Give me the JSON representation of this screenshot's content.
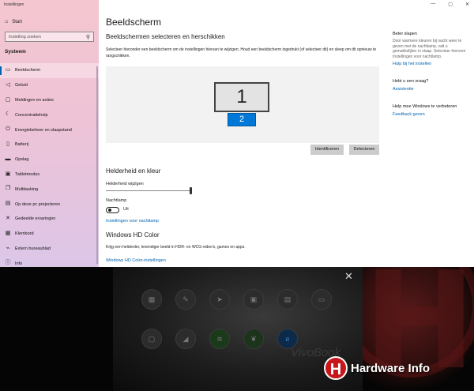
{
  "window": {
    "title": "Instellingen",
    "controls": [
      "—",
      "▢",
      "✕"
    ]
  },
  "sidebar": {
    "home_label": "Start",
    "search_placeholder": "Instelling zoeken",
    "section_title": "Systeem",
    "items": [
      {
        "label": "Beeldscherm",
        "icon": "monitor-icon",
        "glyph": "▭",
        "active": true
      },
      {
        "label": "Geluid",
        "icon": "speaker-icon",
        "glyph": "◁"
      },
      {
        "label": "Meldingen en acties",
        "icon": "notification-icon",
        "glyph": "▢"
      },
      {
        "label": "Concentratiehulp",
        "icon": "moon-icon",
        "glyph": "☾"
      },
      {
        "label": "Energiebeheer en slaapstand",
        "icon": "power-icon",
        "glyph": "⏻"
      },
      {
        "label": "Batterij",
        "icon": "battery-icon",
        "glyph": "▯"
      },
      {
        "label": "Opslag",
        "icon": "storage-icon",
        "glyph": "▬"
      },
      {
        "label": "Tabletmodus",
        "icon": "tablet-icon",
        "glyph": "▣"
      },
      {
        "label": "Multitasking",
        "icon": "multitask-icon",
        "glyph": "❐"
      },
      {
        "label": "Op deze pc projecteren",
        "icon": "project-icon",
        "glyph": "▤"
      },
      {
        "label": "Gedeelde ervaringen",
        "icon": "share-icon",
        "glyph": "✕"
      },
      {
        "label": "Klembord",
        "icon": "clipboard-icon",
        "glyph": "▦"
      },
      {
        "label": "Extern bureaublad",
        "icon": "remote-icon",
        "glyph": "⌁"
      },
      {
        "label": "Info",
        "icon": "info-icon",
        "glyph": "ⓘ"
      }
    ]
  },
  "main": {
    "title": "Beeldscherm",
    "arrange_heading": "Beeldschermen selecteren en herschikken",
    "arrange_desc": "Selecteer hieronder een beeldscherm om de instellingen hiervan te wijzigen. Houd een beeldscherm ingedrukt (of selecteer dit) en sleep om dit opnieuw te rangschikken.",
    "monitor1": "1",
    "monitor2": "2",
    "identify_button": "Identificeren",
    "detect_button": "Detecteren",
    "brightness_heading": "Helderheid en kleur",
    "brightness_label": "Helderheid wijzigen",
    "nightlight_label": "Nachtlamp",
    "nightlight_state": "Uit",
    "nightlight_link": "Instellingen voor nachtlamp",
    "hd_heading": "Windows HD Color",
    "hd_desc": "Krijg een helderder, levendiger beeld in HDR- en WCG-video's, games en apps.",
    "hd_link": "Windows HD Color-instellingen"
  },
  "right_panel": {
    "sleep_title": "Beter slapen",
    "sleep_desc": "Door warmere kleuren bij nacht weer te geven met de nachtlamp, valt u gemakkelijker in slaap. Selecteer hiervoor Instellingen voor nachtlamp.",
    "sleep_link": "Hulp bij het instellen",
    "question_title": "Hebt u een vraag?",
    "question_link": "Assistentie",
    "improve_title": "Help mee Windows te verbeteren",
    "improve_link": "Feedback geven"
  },
  "overlay": {
    "laptop_text": "VivoBook",
    "brand_letter": "H",
    "brand_name": "Hardware Info"
  }
}
